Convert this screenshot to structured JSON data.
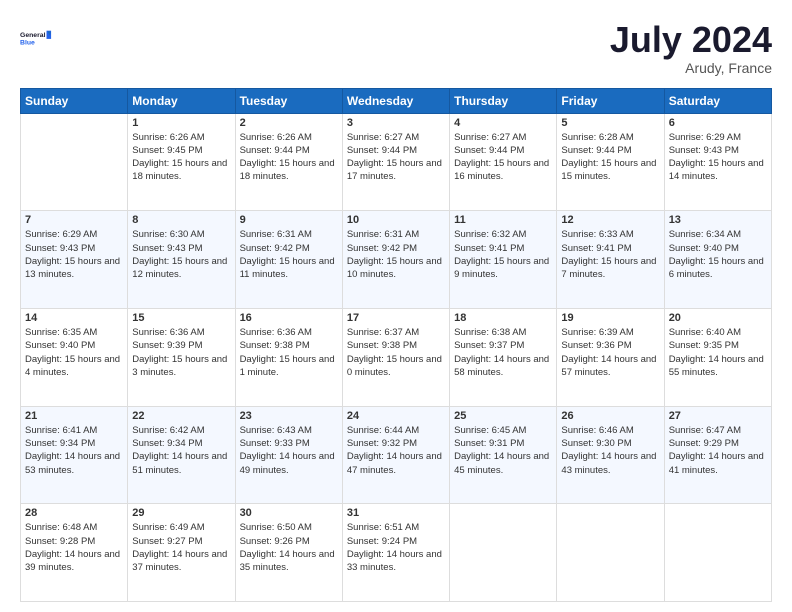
{
  "header": {
    "logo_line1": "General",
    "logo_line2": "Blue",
    "month_title": "July 2024",
    "location": "Arudy, France"
  },
  "weekdays": [
    "Sunday",
    "Monday",
    "Tuesday",
    "Wednesday",
    "Thursday",
    "Friday",
    "Saturday"
  ],
  "weeks": [
    [
      {
        "day": "",
        "sunrise": "",
        "sunset": "",
        "daylight": ""
      },
      {
        "day": "1",
        "sunrise": "Sunrise: 6:26 AM",
        "sunset": "Sunset: 9:45 PM",
        "daylight": "Daylight: 15 hours and 18 minutes."
      },
      {
        "day": "2",
        "sunrise": "Sunrise: 6:26 AM",
        "sunset": "Sunset: 9:44 PM",
        "daylight": "Daylight: 15 hours and 18 minutes."
      },
      {
        "day": "3",
        "sunrise": "Sunrise: 6:27 AM",
        "sunset": "Sunset: 9:44 PM",
        "daylight": "Daylight: 15 hours and 17 minutes."
      },
      {
        "day": "4",
        "sunrise": "Sunrise: 6:27 AM",
        "sunset": "Sunset: 9:44 PM",
        "daylight": "Daylight: 15 hours and 16 minutes."
      },
      {
        "day": "5",
        "sunrise": "Sunrise: 6:28 AM",
        "sunset": "Sunset: 9:44 PM",
        "daylight": "Daylight: 15 hours and 15 minutes."
      },
      {
        "day": "6",
        "sunrise": "Sunrise: 6:29 AM",
        "sunset": "Sunset: 9:43 PM",
        "daylight": "Daylight: 15 hours and 14 minutes."
      }
    ],
    [
      {
        "day": "7",
        "sunrise": "Sunrise: 6:29 AM",
        "sunset": "Sunset: 9:43 PM",
        "daylight": "Daylight: 15 hours and 13 minutes."
      },
      {
        "day": "8",
        "sunrise": "Sunrise: 6:30 AM",
        "sunset": "Sunset: 9:43 PM",
        "daylight": "Daylight: 15 hours and 12 minutes."
      },
      {
        "day": "9",
        "sunrise": "Sunrise: 6:31 AM",
        "sunset": "Sunset: 9:42 PM",
        "daylight": "Daylight: 15 hours and 11 minutes."
      },
      {
        "day": "10",
        "sunrise": "Sunrise: 6:31 AM",
        "sunset": "Sunset: 9:42 PM",
        "daylight": "Daylight: 15 hours and 10 minutes."
      },
      {
        "day": "11",
        "sunrise": "Sunrise: 6:32 AM",
        "sunset": "Sunset: 9:41 PM",
        "daylight": "Daylight: 15 hours and 9 minutes."
      },
      {
        "day": "12",
        "sunrise": "Sunrise: 6:33 AM",
        "sunset": "Sunset: 9:41 PM",
        "daylight": "Daylight: 15 hours and 7 minutes."
      },
      {
        "day": "13",
        "sunrise": "Sunrise: 6:34 AM",
        "sunset": "Sunset: 9:40 PM",
        "daylight": "Daylight: 15 hours and 6 minutes."
      }
    ],
    [
      {
        "day": "14",
        "sunrise": "Sunrise: 6:35 AM",
        "sunset": "Sunset: 9:40 PM",
        "daylight": "Daylight: 15 hours and 4 minutes."
      },
      {
        "day": "15",
        "sunrise": "Sunrise: 6:36 AM",
        "sunset": "Sunset: 9:39 PM",
        "daylight": "Daylight: 15 hours and 3 minutes."
      },
      {
        "day": "16",
        "sunrise": "Sunrise: 6:36 AM",
        "sunset": "Sunset: 9:38 PM",
        "daylight": "Daylight: 15 hours and 1 minute."
      },
      {
        "day": "17",
        "sunrise": "Sunrise: 6:37 AM",
        "sunset": "Sunset: 9:38 PM",
        "daylight": "Daylight: 15 hours and 0 minutes."
      },
      {
        "day": "18",
        "sunrise": "Sunrise: 6:38 AM",
        "sunset": "Sunset: 9:37 PM",
        "daylight": "Daylight: 14 hours and 58 minutes."
      },
      {
        "day": "19",
        "sunrise": "Sunrise: 6:39 AM",
        "sunset": "Sunset: 9:36 PM",
        "daylight": "Daylight: 14 hours and 57 minutes."
      },
      {
        "day": "20",
        "sunrise": "Sunrise: 6:40 AM",
        "sunset": "Sunset: 9:35 PM",
        "daylight": "Daylight: 14 hours and 55 minutes."
      }
    ],
    [
      {
        "day": "21",
        "sunrise": "Sunrise: 6:41 AM",
        "sunset": "Sunset: 9:34 PM",
        "daylight": "Daylight: 14 hours and 53 minutes."
      },
      {
        "day": "22",
        "sunrise": "Sunrise: 6:42 AM",
        "sunset": "Sunset: 9:34 PM",
        "daylight": "Daylight: 14 hours and 51 minutes."
      },
      {
        "day": "23",
        "sunrise": "Sunrise: 6:43 AM",
        "sunset": "Sunset: 9:33 PM",
        "daylight": "Daylight: 14 hours and 49 minutes."
      },
      {
        "day": "24",
        "sunrise": "Sunrise: 6:44 AM",
        "sunset": "Sunset: 9:32 PM",
        "daylight": "Daylight: 14 hours and 47 minutes."
      },
      {
        "day": "25",
        "sunrise": "Sunrise: 6:45 AM",
        "sunset": "Sunset: 9:31 PM",
        "daylight": "Daylight: 14 hours and 45 minutes."
      },
      {
        "day": "26",
        "sunrise": "Sunrise: 6:46 AM",
        "sunset": "Sunset: 9:30 PM",
        "daylight": "Daylight: 14 hours and 43 minutes."
      },
      {
        "day": "27",
        "sunrise": "Sunrise: 6:47 AM",
        "sunset": "Sunset: 9:29 PM",
        "daylight": "Daylight: 14 hours and 41 minutes."
      }
    ],
    [
      {
        "day": "28",
        "sunrise": "Sunrise: 6:48 AM",
        "sunset": "Sunset: 9:28 PM",
        "daylight": "Daylight: 14 hours and 39 minutes."
      },
      {
        "day": "29",
        "sunrise": "Sunrise: 6:49 AM",
        "sunset": "Sunset: 9:27 PM",
        "daylight": "Daylight: 14 hours and 37 minutes."
      },
      {
        "day": "30",
        "sunrise": "Sunrise: 6:50 AM",
        "sunset": "Sunset: 9:26 PM",
        "daylight": "Daylight: 14 hours and 35 minutes."
      },
      {
        "day": "31",
        "sunrise": "Sunrise: 6:51 AM",
        "sunset": "Sunset: 9:24 PM",
        "daylight": "Daylight: 14 hours and 33 minutes."
      },
      {
        "day": "",
        "sunrise": "",
        "sunset": "",
        "daylight": ""
      },
      {
        "day": "",
        "sunrise": "",
        "sunset": "",
        "daylight": ""
      },
      {
        "day": "",
        "sunrise": "",
        "sunset": "",
        "daylight": ""
      }
    ]
  ]
}
